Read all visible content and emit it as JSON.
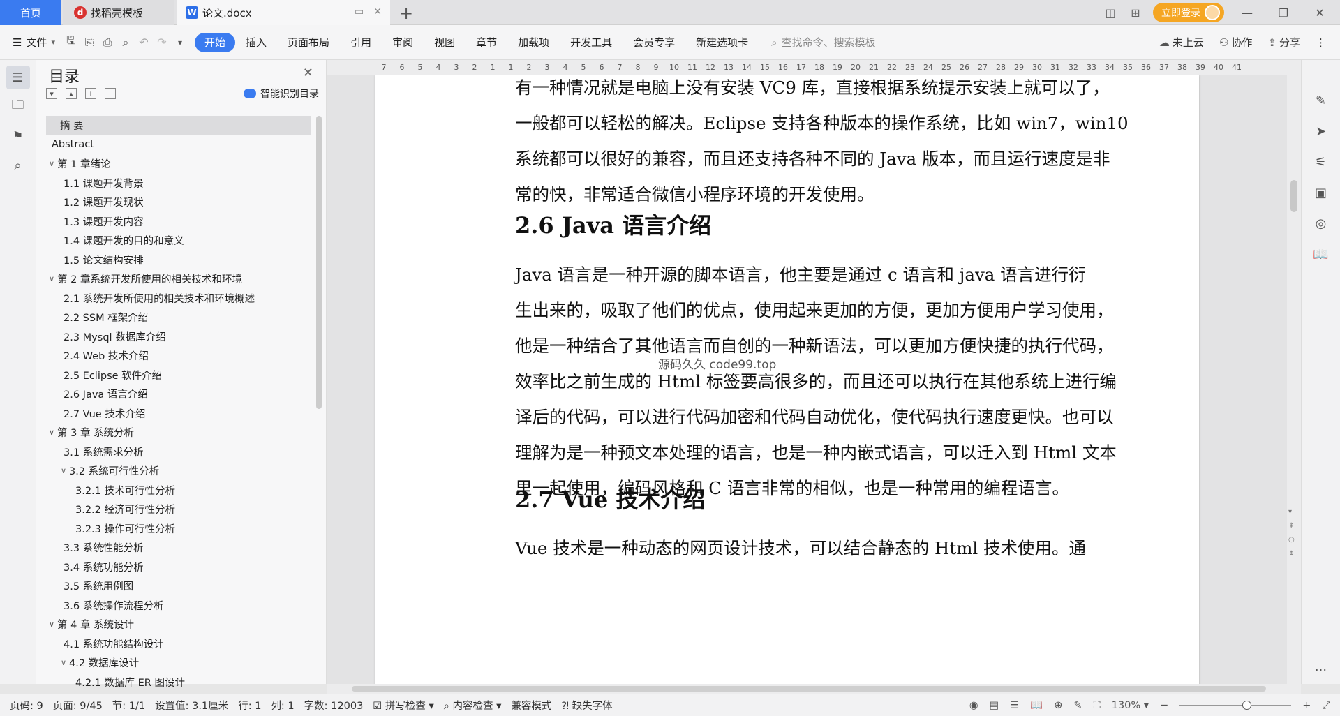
{
  "titlebar": {
    "tabs": [
      {
        "label": "首页"
      },
      {
        "label": "找稻壳模板"
      },
      {
        "label": "论文.docx"
      }
    ],
    "login_label": "立即登录"
  },
  "toolbar": {
    "file_label": "文件",
    "ribbon_tabs": [
      "开始",
      "插入",
      "页面布局",
      "引用",
      "审阅",
      "视图",
      "章节",
      "加载项",
      "开发工具",
      "会员专享",
      "新建选项卡"
    ],
    "search_placeholder": "查找命令、搜索模板",
    "cloud_label": "未上云",
    "collab_label": "协作",
    "share_label": "分享"
  },
  "toc": {
    "title": "目录",
    "smart_label": "智能识别目录",
    "items": [
      {
        "label": "摘  要",
        "level": 0,
        "arrow": ""
      },
      {
        "label": "Abstract",
        "level": 0,
        "arrow": ""
      },
      {
        "label": "第 1 章绪论",
        "level": 0,
        "arrow": "v"
      },
      {
        "label": "1.1 课题开发背景",
        "level": 1,
        "arrow": ""
      },
      {
        "label": "1.2 课题开发现状",
        "level": 1,
        "arrow": ""
      },
      {
        "label": "1.3 课题开发内容",
        "level": 1,
        "arrow": ""
      },
      {
        "label": "1.4 课题开发的目的和意义",
        "level": 1,
        "arrow": ""
      },
      {
        "label": "1.5 论文结构安排",
        "level": 1,
        "arrow": ""
      },
      {
        "label": "第 2 章系统开发所使用的相关技术和环境",
        "level": 0,
        "arrow": "v"
      },
      {
        "label": "2.1 系统开发所使用的相关技术和环境概述",
        "level": 1,
        "arrow": ""
      },
      {
        "label": "2.2 SSM 框架介绍",
        "level": 1,
        "arrow": ""
      },
      {
        "label": "2.3 Mysql 数据库介绍",
        "level": 1,
        "arrow": ""
      },
      {
        "label": "2.4 Web 技术介绍",
        "level": 1,
        "arrow": ""
      },
      {
        "label": "2.5 Eclipse 软件介绍",
        "level": 1,
        "arrow": ""
      },
      {
        "label": "2.6 Java 语言介绍",
        "level": 1,
        "arrow": ""
      },
      {
        "label": "2.7 Vue 技术介绍",
        "level": 1,
        "arrow": ""
      },
      {
        "label": "第 3 章  系统分析",
        "level": 0,
        "arrow": "v"
      },
      {
        "label": "3.1 系统需求分析",
        "level": 1,
        "arrow": ""
      },
      {
        "label": "3.2 系统可行性分析",
        "level": 1,
        "arrow": "v"
      },
      {
        "label": "3.2.1 技术可行性分析",
        "level": 2,
        "arrow": ""
      },
      {
        "label": "3.2.2 经济可行性分析",
        "level": 2,
        "arrow": ""
      },
      {
        "label": "3.2.3 操作可行性分析",
        "level": 2,
        "arrow": ""
      },
      {
        "label": "3.3 系统性能分析",
        "level": 1,
        "arrow": ""
      },
      {
        "label": "3.4  系统功能分析",
        "level": 1,
        "arrow": ""
      },
      {
        "label": "3.5 系统用例图",
        "level": 1,
        "arrow": ""
      },
      {
        "label": "3.6 系统操作流程分析",
        "level": 1,
        "arrow": ""
      },
      {
        "label": "第 4 章  系统设计",
        "level": 0,
        "arrow": "v"
      },
      {
        "label": "4.1 系统功能结构设计",
        "level": 1,
        "arrow": ""
      },
      {
        "label": "4.2 数据库设计",
        "level": 1,
        "arrow": "v"
      },
      {
        "label": "4.2.1 数据库 ER 图设计",
        "level": 2,
        "arrow": ""
      }
    ]
  },
  "document": {
    "lines_top": [
      "有一种情况就是电脑上没有安装 VC9 库，直接根据系统提示安装上就可以了，",
      "一般都可以轻松的解决。Eclipse 支持各种版本的操作系统，比如 win7，win10",
      "系统都可以很好的兼容，而且还支持各种不同的 Java 版本，而且运行速度是非",
      "常的快，非常适合微信小程序环境的开发使用。"
    ],
    "heading_26": "2.6 Java 语言介绍",
    "lines_java": [
      "    Java 语言是一种开源的脚本语言，他主要是通过 c 语言和 java 语言进行衍",
      "生出来的，吸取了他们的优点，使用起来更加的方便，更加方便用户学习使用，",
      "他是一种结合了其他语言而自创的一种新语法，可以更加方便快捷的执行代码，",
      "效率比之前生成的 Html 标签要高很多的，而且还可以执行在其他系统上进行编",
      "译后的代码，可以进行代码加密和代码自动优化，使代码执行速度更快。也可以",
      "理解为是一种预文本处理的语言，也是一种内嵌式语言，可以迁入到 Html 文本",
      "里一起使用，编码风格和 C 语言非常的相似，也是一种常用的编程语言。"
    ],
    "heading_27": "2.7 Vue 技术介绍",
    "lines_vue": [
      "    Vue 技术是一种动态的网页设计技术，可以结合静态的 Html 技术使用。通"
    ],
    "watermark": "源码久久 code99.top"
  },
  "ruler": {
    "numbers": [
      "7",
      "6",
      "5",
      "4",
      "3",
      "2",
      "1",
      "1",
      "2",
      "3",
      "4",
      "5",
      "6",
      "7",
      "8",
      "9",
      "10",
      "11",
      "12",
      "13",
      "14",
      "15",
      "16",
      "17",
      "18",
      "19",
      "20",
      "21",
      "22",
      "23",
      "24",
      "25",
      "26",
      "27",
      "28",
      "29",
      "30",
      "31",
      "32",
      "33",
      "34",
      "35",
      "36",
      "37",
      "38",
      "39",
      "40",
      "41"
    ]
  },
  "status": {
    "page_num": "页码: 9",
    "pages": "页面: 9/45",
    "section": "节: 1/1",
    "setting": "设置值: 3.1厘米",
    "row": "行: 1",
    "col": "列: 1",
    "words": "字数: 12003",
    "spell": "拼写检查",
    "content_check": "内容检查",
    "compat": "兼容模式",
    "missing_font": "缺失字体",
    "zoom": "130%"
  },
  "colors": {
    "accent": "#3a7bf0",
    "login": "#f5a623"
  }
}
